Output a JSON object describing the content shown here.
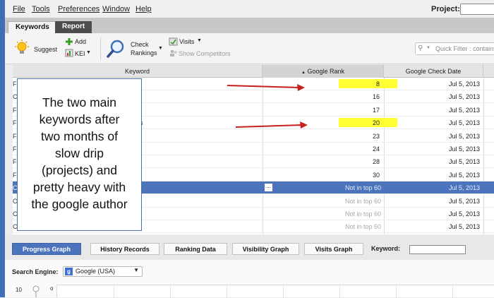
{
  "menu": {
    "items": [
      "File",
      "Tools",
      "Preferences",
      "Window",
      "Help"
    ],
    "project_label": "Project:"
  },
  "tabs": [
    "Keywords",
    "Report"
  ],
  "toolbar": {
    "suggest": "Suggest",
    "add": "Add",
    "kei": "KEI",
    "check": "Check",
    "rankings": "Rankings",
    "visits": "Visits",
    "show_competitors": "Show Competitors",
    "quick_filter": "Quick Filter : contains"
  },
  "table": {
    "headers": [
      "Keyword",
      "Google Rank",
      "Google Check Date"
    ],
    "sort_indicator": "▲",
    "rows": [
      {
        "kw": "F",
        "rank": "8",
        "date": "Jul 5, 2013",
        "highlight": true
      },
      {
        "kw": "C",
        "rank": "16",
        "date": "Jul 5, 2013"
      },
      {
        "kw": "F",
        "rank": "17",
        "date": "Jul 5, 2013"
      },
      {
        "kw": "F",
        "kw_tail": "s",
        "rank": "20",
        "date": "Jul 5, 2013",
        "highlight": true
      },
      {
        "kw": "F",
        "rank": "23",
        "date": "Jul 5, 2013"
      },
      {
        "kw": "F",
        "rank": "24",
        "date": "Jul 5, 2013"
      },
      {
        "kw": "F",
        "rank": "28",
        "date": "Jul 5, 2013"
      },
      {
        "kw": "F",
        "rank": "30",
        "date": "Jul 5, 2013"
      },
      {
        "kw": "C",
        "rank": "Not in top 60",
        "date": "Jul 5, 2013",
        "selected": true
      },
      {
        "kw": "C",
        "rank": "Not in top 60",
        "date": "Jul 5, 2013",
        "muted": true
      },
      {
        "kw": "C",
        "rank": "Not in top 60",
        "date": "Jul 5, 2013",
        "muted": true
      },
      {
        "kw": "C",
        "rank": "Not in top 60",
        "date": "Jul 5, 2013",
        "muted": true
      }
    ],
    "ellipsis": "..."
  },
  "callout": {
    "lines": [
      "The two main",
      "keywords after",
      "two months of",
      "slow drip",
      "(projects) and",
      "pretty heavy with",
      "the google author"
    ]
  },
  "bottom_tabs": [
    "Progress Graph",
    "History Records",
    "Ranking Data",
    "Visibility Graph",
    "Visits Graph"
  ],
  "keyword_label": "Keyword:",
  "search_engine": {
    "label": "Search Engine:",
    "value": "Google (USA)",
    "icon_letter": "g"
  },
  "graph": {
    "y_tick": "10",
    "marker": "o"
  },
  "colors": {
    "accent": "#4b74bc",
    "highlight": "#ffff33",
    "arrow": "#c8211e"
  }
}
